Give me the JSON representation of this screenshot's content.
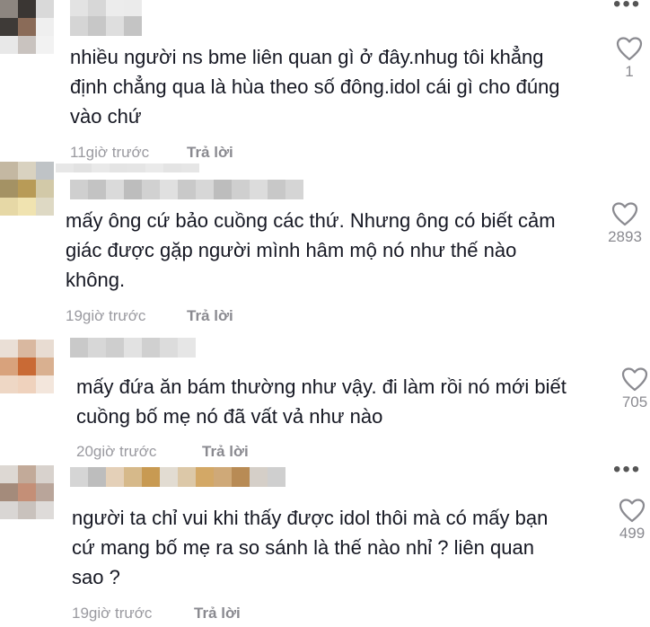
{
  "comments": [
    {
      "text": "nhiều người ns bme liên quan gì ở đây.nhug tôi khẳng\nđịnh chẳng qua là hùa theo số đông.idol cái gì cho đúng\nvào chứ",
      "time": "11giờ trước",
      "reply_label": "Trả lời",
      "likes": "1",
      "has_more": true
    },
    {
      "text": "mấy ông cứ bảo cuồng các thứ. Nhưng ông có biết cảm\ngiác được gặp người mình hâm mộ nó như thế nào\nkhông.",
      "time": "19giờ trước",
      "reply_label": "Trả lời",
      "likes": "2893",
      "has_more": false
    },
    {
      "text": "mấy đứa ăn bám thường như vậy. đi làm rồi nó mới biết\ncuồng bố mẹ nó đã vất vả như nào",
      "time": "20giờ trước",
      "reply_label": "Trả lời",
      "likes": "705",
      "has_more": false
    },
    {
      "text": "người ta chỉ vui khi thấy được idol thôi mà có mấy bạn\ncứ mang bố mẹ ra so sánh là thế nào nhỉ ? liên quan\nsao ?",
      "time": "19giờ trước",
      "reply_label": "Trả lời",
      "likes": "499",
      "has_more": true
    }
  ],
  "icons": {
    "like": "heart-outline-icon",
    "more": "more-dots-icon"
  },
  "colors": {
    "text": "#161823",
    "meta": "#9a9aa0",
    "icon": "#8a8a90"
  }
}
